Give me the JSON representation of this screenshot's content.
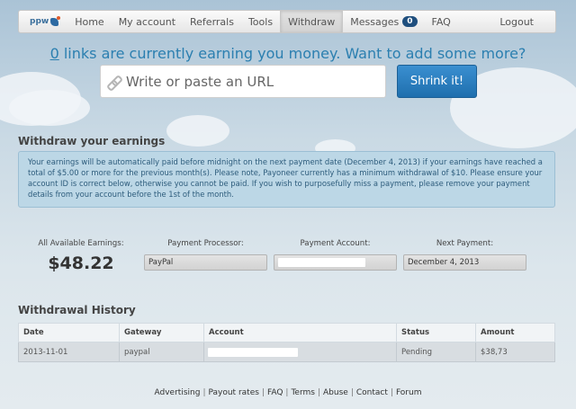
{
  "nav": {
    "brand": "ppw",
    "items": [
      "Home",
      "My account",
      "Referrals",
      "Tools",
      "Withdraw",
      "Messages",
      "FAQ"
    ],
    "messages_count": "0",
    "logout": "Logout"
  },
  "banner": {
    "count": "0",
    "text": " links are currently earning you money. Want to add some more?",
    "url_placeholder": "Write or paste an URL",
    "shrink_button": "Shrink it!"
  },
  "withdraw": {
    "title": "Withdraw your earnings",
    "notice": "Your earnings will be automatically paid before midnight on the next payment date (December 4, 2013) if your earnings have reached a total of $5.00 or more for the previous month(s). Please note, Payoneer currently has a minimum withdrawal of $10. Please ensure your account ID is correct below, otherwise you cannot be paid. If you wish to purposefully miss a payment, please remove your payment details from your account before the 1st of the month.",
    "available_label": "All Available Earnings:",
    "available_value": "$48.22",
    "processor_label": "Payment Processor:",
    "processor_value": "PayPal",
    "account_label": "Payment Account:",
    "next_label": "Next Payment:",
    "next_value": "December 4, 2013"
  },
  "history": {
    "title": "Withdrawal History",
    "columns": [
      "Date",
      "Gateway",
      "Account",
      "Status",
      "Amount"
    ],
    "rows": [
      {
        "date": "2013-11-01",
        "gateway": "paypal",
        "status": "Pending",
        "amount": "$38,73"
      }
    ]
  },
  "footer": {
    "links": [
      "Advertising",
      "Payout rates",
      "FAQ",
      "Terms",
      "Abuse",
      "Contact",
      "Forum"
    ]
  }
}
